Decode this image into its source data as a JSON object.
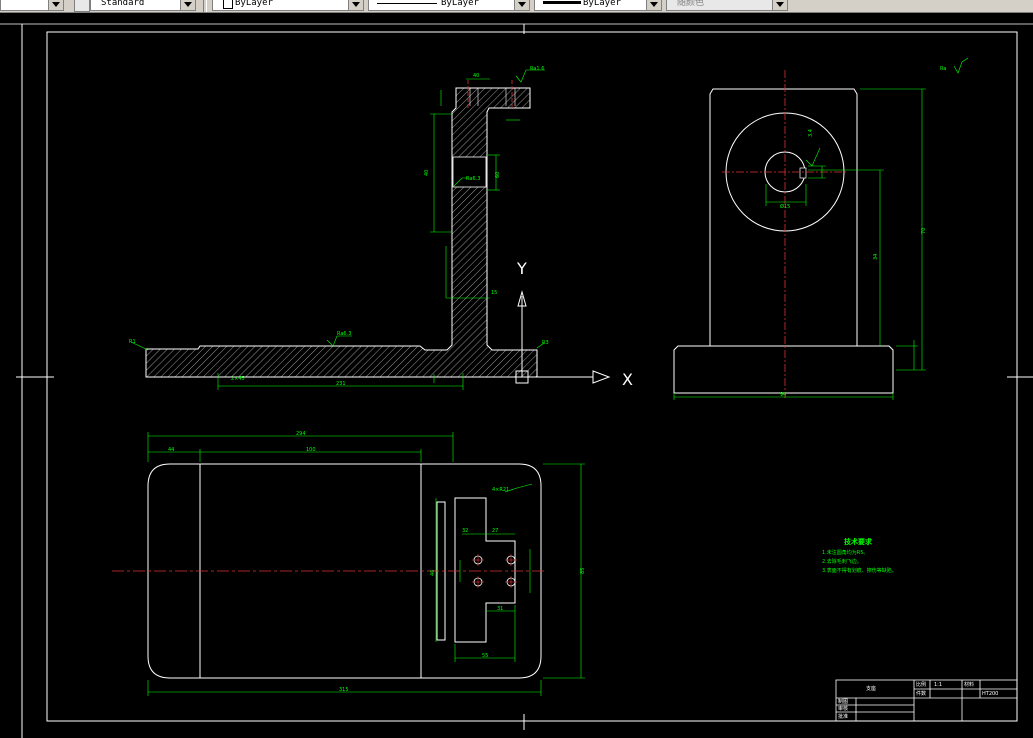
{
  "toolbar": {
    "text_style": "Standard",
    "layer": "ByLayer",
    "linetype": "ByLayer",
    "lineweight": "ByLayer",
    "plot_style": "随颜色"
  },
  "ucs": {
    "y_label": "Y",
    "x_label": "X"
  },
  "front_view": {
    "label_left_edge": "R1",
    "label_right_edge": "R3",
    "roughness_top": "Ra6.3",
    "roughness_mid": "Ra6.3",
    "roughness_top_right": "Ra1.6",
    "dim_top_width": "40",
    "dim_left_height": "40",
    "dim_slot": "60",
    "dim_bottom_run": "231",
    "dim_short": "2×45",
    "dim_mid": "15"
  },
  "side_view": {
    "dim_height_total": "70",
    "dim_center_height": "34",
    "dim_base_width": "94",
    "dim_bore": "Ø15",
    "dim_keyway": "3.4",
    "roughness": "Ra"
  },
  "top_view": {
    "dim_overall_top": "294",
    "dim_left_offset": "44",
    "dim_center_span": "100",
    "dim_overall_bottom": "315",
    "dim_height_right": "85",
    "dim_height_mid": "46",
    "dim_corner": "4×R21",
    "dim_hole_a": "32",
    "dim_hole_b": "27",
    "dim_hole_c": "31",
    "dim_hole_d": "55"
  },
  "notes": {
    "title": "技术要求",
    "lines": [
      "1.未注圆角均为R5。",
      "2.去除毛刺飞边。",
      "3.表面不得有划痕、擦伤等缺陷。"
    ]
  },
  "title_block": {
    "part_name": "支座",
    "scale_label": "比例",
    "scale_value": "1:1",
    "qty_label": "件数",
    "material_label": "材料",
    "material_value": "HT200",
    "drawn_by": "制图",
    "checked_by": "审核",
    "approved_by": "批准"
  }
}
